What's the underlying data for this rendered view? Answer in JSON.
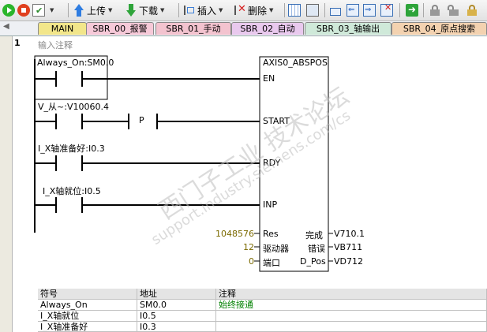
{
  "toolbar": {
    "upload_label": "上传",
    "download_label": "下载",
    "insert_label": "插入",
    "delete_label": "删除"
  },
  "tabs": [
    {
      "label": "MAIN",
      "color": "#f2e68a"
    },
    {
      "label": "SBR_00_报警",
      "color": "#f6c9d8"
    },
    {
      "label": "SBR_01_手动",
      "color": "#f3c3cf"
    },
    {
      "label": "SBR_02_自动",
      "color": "#e9c9ee"
    },
    {
      "label": "SBR_03_轴输出",
      "color": "#cfe9d9"
    },
    {
      "label": "SBR_04_原点搜索",
      "color": "#f3d2b0"
    }
  ],
  "network": {
    "number": "1",
    "comment": "输入注释"
  },
  "contacts": {
    "c1": "Always_On:SM0.0",
    "c2": "V_从~:V10060.4",
    "c2_edge": "P",
    "c3": "I_X轴准备好:I0.3",
    "c4": "I_X轴就位:I0.5"
  },
  "block": {
    "title": "AXIS0_ABSPOS",
    "en": "EN",
    "start": "START",
    "rdy": "RDY",
    "inp": "INP",
    "res": "Res",
    "drive": "驱动器",
    "port": "端口",
    "done": "完成",
    "error": "错误",
    "dpos": "D_Pos",
    "res_val": "1048576",
    "drive_val": "12",
    "port_val": "0",
    "done_out": "V710.1",
    "error_out": "VB711",
    "dpos_out": "VD712"
  },
  "symtable": {
    "headers": [
      "符号",
      "地址",
      "注释"
    ],
    "rows": [
      [
        "Always_On",
        "SM0.0",
        "始终接通"
      ],
      [
        "I_X轴就位",
        "I0.5",
        ""
      ],
      [
        "I_X轴准备好",
        "I0.3",
        ""
      ]
    ]
  },
  "watermark": {
    "line1": "西门子工业 技术论坛",
    "line2": "support.industry.siemens.com/cs"
  },
  "colors": {
    "value_olive": "#7b6a00",
    "comment_green": "#008000"
  }
}
